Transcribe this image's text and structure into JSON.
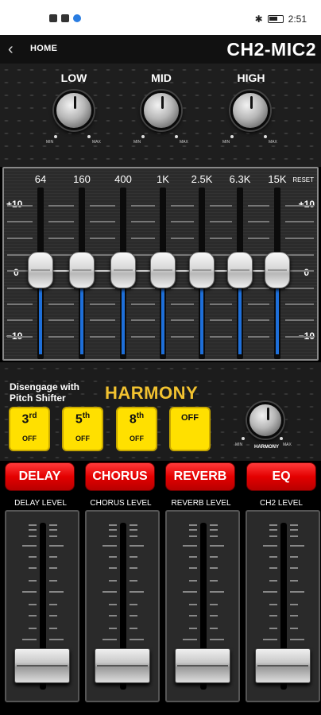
{
  "status_bar": {
    "time": "2:51"
  },
  "header": {
    "back_icon": "chevron-left-icon",
    "home_label": "HOME",
    "title": "CH2-MIC2"
  },
  "tone_knobs": {
    "min_label": "MIN",
    "max_label": "MAX",
    "knobs": [
      {
        "label": "LOW"
      },
      {
        "label": "MID"
      },
      {
        "label": "HIGH"
      }
    ]
  },
  "eq": {
    "reset_label": "RESET",
    "scale": {
      "top": "+10",
      "mid": "0",
      "bottom": "−10"
    },
    "bands": [
      {
        "freq": "64",
        "value": 0
      },
      {
        "freq": "160",
        "value": 0
      },
      {
        "freq": "400",
        "value": 0
      },
      {
        "freq": "1K",
        "value": 0
      },
      {
        "freq": "2.5K",
        "value": 0
      },
      {
        "freq": "6.3K",
        "value": 0
      },
      {
        "freq": "15K",
        "value": 0
      }
    ]
  },
  "harmony": {
    "note": [
      "Disengage with",
      "Pitch Shifter"
    ],
    "title": "HARMONY",
    "buttons": [
      {
        "num": "3",
        "sup": "rd",
        "state": "OFF"
      },
      {
        "num": "5",
        "sup": "th",
        "state": "OFF"
      },
      {
        "num": "8",
        "sup": "th",
        "state": "OFF"
      },
      {
        "state": "OFF"
      }
    ],
    "knob_label": "HARMONY",
    "min_label": "MIN",
    "max_label": "MAX"
  },
  "effects": [
    "DELAY",
    "CHORUS",
    "REVERB",
    "EQ"
  ],
  "levels": [
    {
      "label": "DELAY LEVEL",
      "value": 0
    },
    {
      "label": "CHORUS LEVEL",
      "value": 0
    },
    {
      "label": "REVERB LEVEL",
      "value": 0
    },
    {
      "label": "CH2 LEVEL",
      "value": 0
    }
  ],
  "colors": {
    "accent_yellow": "#ffe000",
    "accent_red": "#e40000",
    "eq_blue": "#1e6fd9",
    "harmony_gold": "#f2c230"
  }
}
